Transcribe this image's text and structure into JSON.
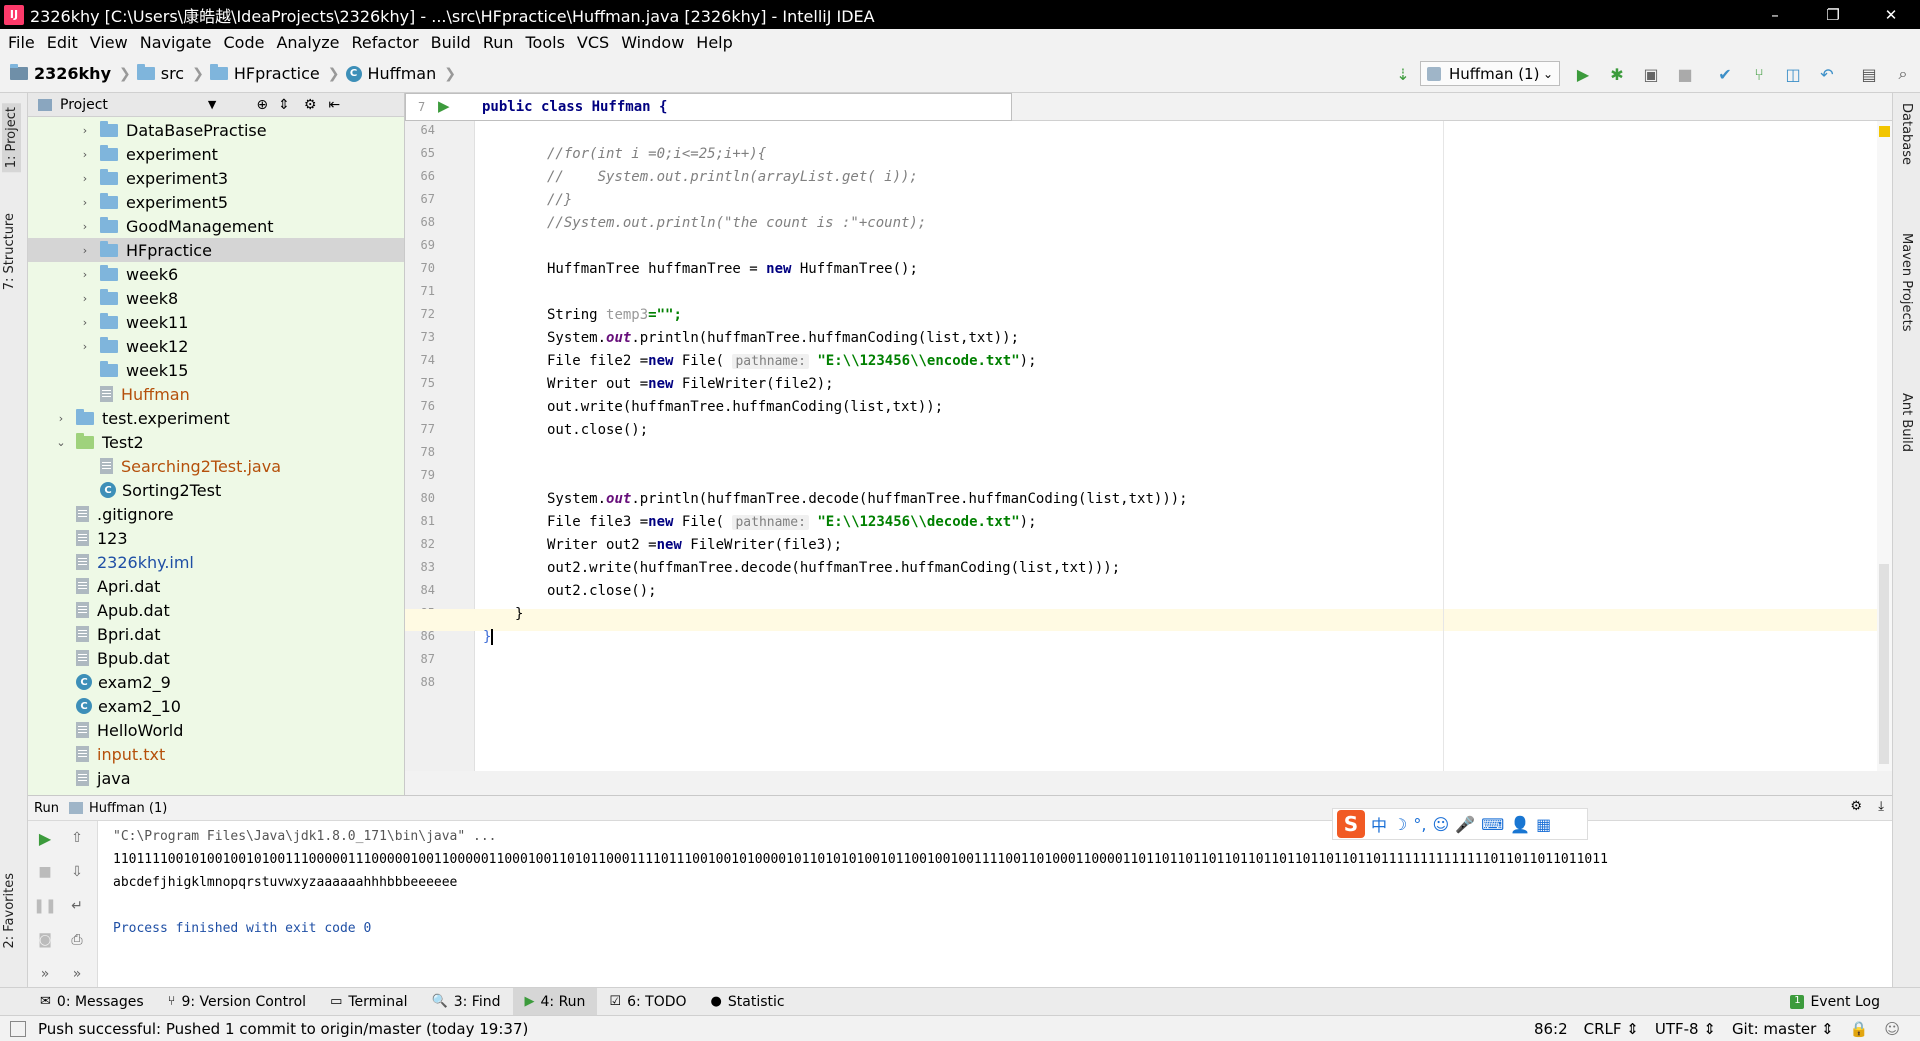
{
  "window": {
    "app_icon": "IJ",
    "title": "2326khy [C:\\Users\\康皓越\\IdeaProjects\\2326khy] - ...\\src\\HFpractice\\Huffman.java [2326khy] - IntelliJ IDEA",
    "controls": [
      "–",
      "❐",
      "✕"
    ]
  },
  "menu": [
    "File",
    "Edit",
    "View",
    "Navigate",
    "Code",
    "Analyze",
    "Refactor",
    "Build",
    "Run",
    "Tools",
    "VCS",
    "Window",
    "Help"
  ],
  "breadcrumbs": [
    "2326khy",
    "src",
    "HFpractice",
    "Huffman"
  ],
  "run_config": "Huffman (1)",
  "project_panel": {
    "title": "Project",
    "items": [
      {
        "label": "DataBasePractise",
        "kind": "folder",
        "indent": 2,
        "arrow": "›"
      },
      {
        "label": "experiment",
        "kind": "folder",
        "indent": 2,
        "arrow": "›"
      },
      {
        "label": "experiment3",
        "kind": "folder",
        "indent": 2,
        "arrow": "›"
      },
      {
        "label": "experiment5",
        "kind": "folder",
        "indent": 2,
        "arrow": "›"
      },
      {
        "label": "GoodManagement",
        "kind": "folder",
        "indent": 2,
        "arrow": "›"
      },
      {
        "label": "HFpractice",
        "kind": "folder",
        "indent": 2,
        "arrow": "›",
        "selected": true
      },
      {
        "label": "week6",
        "kind": "folder",
        "indent": 2,
        "arrow": "›"
      },
      {
        "label": "week8",
        "kind": "folder",
        "indent": 2,
        "arrow": "›"
      },
      {
        "label": "week11",
        "kind": "folder",
        "indent": 2,
        "arrow": "›"
      },
      {
        "label": "week12",
        "kind": "folder",
        "indent": 2,
        "arrow": "›"
      },
      {
        "label": "week15",
        "kind": "folder",
        "indent": 2,
        "arrow": ""
      },
      {
        "label": "Huffman",
        "kind": "file",
        "indent": 2,
        "arrow": "",
        "color": "#b5500b"
      },
      {
        "label": "test.experiment",
        "kind": "folder",
        "indent": 1,
        "arrow": "›"
      },
      {
        "label": "Test2",
        "kind": "gfolder",
        "indent": 1,
        "arrow": "⌄"
      },
      {
        "label": "Searching2Test.java",
        "kind": "file",
        "indent": 2,
        "arrow": "",
        "color": "#b5500b"
      },
      {
        "label": "Sorting2Test",
        "kind": "class",
        "indent": 2,
        "arrow": ""
      },
      {
        "label": ".gitignore",
        "kind": "file",
        "indent": 1,
        "arrow": ""
      },
      {
        "label": "123",
        "kind": "file",
        "indent": 1,
        "arrow": ""
      },
      {
        "label": "2326khy.iml",
        "kind": "file",
        "indent": 1,
        "arrow": "",
        "color": "#1f4fa5"
      },
      {
        "label": "Apri.dat",
        "kind": "file",
        "indent": 1,
        "arrow": ""
      },
      {
        "label": "Apub.dat",
        "kind": "file",
        "indent": 1,
        "arrow": ""
      },
      {
        "label": "Bpri.dat",
        "kind": "file",
        "indent": 1,
        "arrow": ""
      },
      {
        "label": "Bpub.dat",
        "kind": "file",
        "indent": 1,
        "arrow": ""
      },
      {
        "label": "exam2_9",
        "kind": "class",
        "indent": 1,
        "arrow": ""
      },
      {
        "label": "exam2_10",
        "kind": "class",
        "indent": 1,
        "arrow": ""
      },
      {
        "label": "HelloWorld",
        "kind": "file",
        "indent": 1,
        "arrow": ""
      },
      {
        "label": "input.txt",
        "kind": "file",
        "indent": 1,
        "arrow": "",
        "color": "#b5500b"
      },
      {
        "label": "java",
        "kind": "file",
        "indent": 1,
        "arrow": ""
      }
    ]
  },
  "editor": {
    "sticky_line_no": "7",
    "sticky_text": "public class Huffman {",
    "line_numbers": [
      "64",
      "65",
      "66",
      "67",
      "68",
      "69",
      "70",
      "71",
      "72",
      "73",
      "74",
      "75",
      "76",
      "77",
      "78",
      "79",
      "80",
      "81",
      "82",
      "83",
      "84",
      "85",
      "86",
      "87",
      "88"
    ],
    "code": {
      "l65": "//for(int i =0;i<=25;i++){",
      "l66": "//    System.out.println(arrayList.get( i));",
      "l67": "//}",
      "l68": "//System.out.println(\"the count is :\"+count);",
      "l70a": "HuffmanTree huffmanTree = ",
      "l70kw": "new",
      "l70b": " HuffmanTree();",
      "l72a": "String ",
      "l72var": "temp3",
      "l72b": "=\"\";",
      "l73a": "System.",
      "l73out": "out",
      "l73b": ".println(huffmanTree.huffmanCoding(list,txt));",
      "l74a": "File file2 =",
      "l74kw": "new",
      "l74b": " File( ",
      "l74hint": "pathname:",
      "l74str": " \"E:\\\\123456\\\\encode.txt\"",
      "l74c": ");",
      "l75a": "Writer out =",
      "l75kw": "new",
      "l75b": " FileWriter(file2);",
      "l76": "out.write(huffmanTree.huffmanCoding(list,txt));",
      "l77": "out.close();",
      "l80a": "System.",
      "l80out": "out",
      "l80b": ".println(huffmanTree.decode(huffmanTree.huffmanCoding(list,txt)));",
      "l81a": "File file3 =",
      "l81kw": "new",
      "l81b": " File( ",
      "l81hint": "pathname:",
      "l81str": " \"E:\\\\123456\\\\decode.txt\"",
      "l81c": ");",
      "l82a": "Writer out2 =",
      "l82kw": "new",
      "l82b": " FileWriter(file3);",
      "l83": "out2.write(huffmanTree.decode(huffmanTree.huffmanCoding(list,txt)));",
      "l84": "out2.close();",
      "l85": "}",
      "l86": "}"
    }
  },
  "run_panel": {
    "label": "Run",
    "tab": "Huffman (1)",
    "output": [
      "\"C:\\Program Files\\Java\\jdk1.8.0_171\\bin\\java\" ...",
      "11011110010100100101001110000011100000100110000011000100110101100011110111001001010000101101010100101100100100111100110100011000011011011011011011011011011011011011111111111111011011011011011",
      "abcdefjhigklmnopqrstuvwxyzaaaaaahhhbbbeeeeee",
      "",
      "Process finished with exit code 0"
    ]
  },
  "ime": {
    "logo": "S",
    "items": [
      "中",
      "☽",
      "°,",
      "☺",
      "🎤",
      "⌨",
      "👤",
      "▦"
    ]
  },
  "bottom_tools": [
    {
      "label": "0: Messages",
      "icon": "✉"
    },
    {
      "label": "9: Version Control",
      "icon": "⑂"
    },
    {
      "label": "Terminal",
      "icon": "▭"
    },
    {
      "label": "3: Find",
      "icon": "🔍"
    },
    {
      "label": "4: Run",
      "icon": "▶",
      "active": true
    },
    {
      "label": "6: TODO",
      "icon": "☑"
    },
    {
      "label": "Statistic",
      "icon": "●"
    }
  ],
  "event_log": "Event Log",
  "status": {
    "message": "Push successful: Pushed 1 commit to origin/master (today 19:37)",
    "position": "86:2",
    "line_sep": "CRLF",
    "encoding": "UTF-8",
    "git": "Git: master"
  },
  "side_tabs": {
    "left": [
      "1: Project",
      "7: Structure",
      "2: Favorites"
    ],
    "right": [
      "Database",
      "Maven Projects",
      "Ant Build"
    ]
  },
  "colors": {
    "accent_green": "#3c9b3c",
    "selection": "#d5d5d5",
    "project_bg": "#eef9e6"
  }
}
